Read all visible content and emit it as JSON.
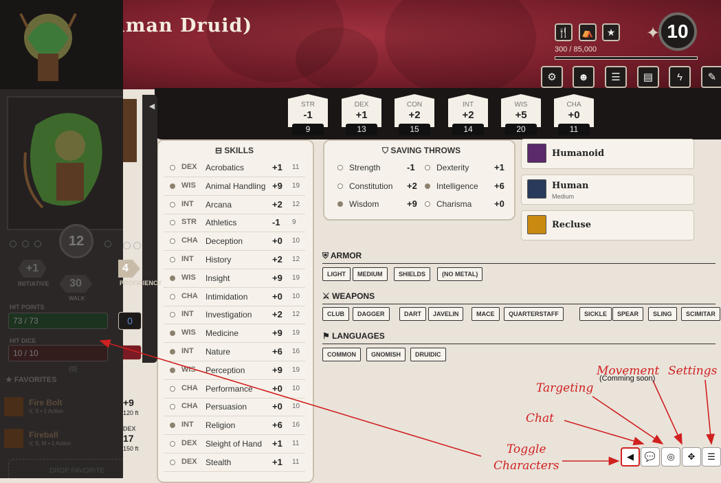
{
  "header": {
    "title": "(Human Druid)",
    "xp": "300 / 85,000",
    "level": "10",
    "icons": [
      "utensils-icon",
      "camp-icon",
      "star-icon"
    ],
    "tools": [
      "gear-icon",
      "character-icon",
      "list-icon",
      "book-icon",
      "lightning-icon",
      "feather-icon"
    ]
  },
  "sidebar": {
    "ac": "12",
    "initiative": "+1",
    "initiative_label": "INITIATIVE",
    "walk": "30",
    "walk_label": "WALK",
    "proficiency": "4",
    "proficiency_label": "PROFICIENCY",
    "hp_label": "HIT POINTS",
    "hp": "73 / 73",
    "hp_temp": "0",
    "hit_dice_label": "HIT DICE",
    "hit_dice": "10 / 10",
    "hit_dice_extra": "(0)",
    "favorites_label": "FAVORITES",
    "favorites": [
      {
        "name": "Fire Bolt",
        "sub": "V, S • 1 Action",
        "bonus": "+9",
        "range": "120 ft"
      },
      {
        "name": "Fireball",
        "sub": "V, S, M • 1 Action",
        "stat": "DEX",
        "bonus": "17",
        "range": "150 ft"
      }
    ],
    "drop_text": "DROP FAVORITE"
  },
  "stats": [
    {
      "label": "STR",
      "mod": "-1",
      "score": "9"
    },
    {
      "label": "DEX",
      "mod": "+1",
      "score": "13"
    },
    {
      "label": "CON",
      "mod": "+2",
      "score": "15"
    },
    {
      "label": "INT",
      "mod": "+2",
      "score": "14"
    },
    {
      "label": "WIS",
      "mod": "+5",
      "score": "20"
    },
    {
      "label": "CHA",
      "mod": "+0",
      "score": "11"
    }
  ],
  "skills": {
    "title": "SKILLS",
    "rows": [
      {
        "ab": "DEX",
        "name": "Acrobatics",
        "bonus": "+1",
        "passive": "11",
        "prof": false
      },
      {
        "ab": "WIS",
        "name": "Animal Handling",
        "bonus": "+9",
        "passive": "19",
        "prof": true
      },
      {
        "ab": "INT",
        "name": "Arcana",
        "bonus": "+2",
        "passive": "12",
        "prof": false
      },
      {
        "ab": "STR",
        "name": "Athletics",
        "bonus": "-1",
        "passive": "9",
        "prof": false
      },
      {
        "ab": "CHA",
        "name": "Deception",
        "bonus": "+0",
        "passive": "10",
        "prof": false
      },
      {
        "ab": "INT",
        "name": "History",
        "bonus": "+2",
        "passive": "12",
        "prof": false
      },
      {
        "ab": "WIS",
        "name": "Insight",
        "bonus": "+9",
        "passive": "19",
        "prof": true
      },
      {
        "ab": "CHA",
        "name": "Intimidation",
        "bonus": "+0",
        "passive": "10",
        "prof": false
      },
      {
        "ab": "INT",
        "name": "Investigation",
        "bonus": "+2",
        "passive": "12",
        "prof": false
      },
      {
        "ab": "WIS",
        "name": "Medicine",
        "bonus": "+9",
        "passive": "19",
        "prof": true
      },
      {
        "ab": "INT",
        "name": "Nature",
        "bonus": "+6",
        "passive": "16",
        "prof": true
      },
      {
        "ab": "WIS",
        "name": "Perception",
        "bonus": "+9",
        "passive": "19",
        "prof": true
      },
      {
        "ab": "CHA",
        "name": "Performance",
        "bonus": "+0",
        "passive": "10",
        "prof": false
      },
      {
        "ab": "CHA",
        "name": "Persuasion",
        "bonus": "+0",
        "passive": "10",
        "prof": false
      },
      {
        "ab": "INT",
        "name": "Religion",
        "bonus": "+6",
        "passive": "16",
        "prof": true
      },
      {
        "ab": "DEX",
        "name": "Sleight of Hand",
        "bonus": "+1",
        "passive": "11",
        "prof": false
      },
      {
        "ab": "DEX",
        "name": "Stealth",
        "bonus": "+1",
        "passive": "11",
        "prof": false
      }
    ]
  },
  "saves": {
    "title": "SAVING THROWS",
    "rows": [
      {
        "name": "Strength",
        "bonus": "-1",
        "prof": false
      },
      {
        "name": "Dexterity",
        "bonus": "+1",
        "prof": false
      },
      {
        "name": "Constitution",
        "bonus": "+2",
        "prof": false
      },
      {
        "name": "Intelligence",
        "bonus": "+6",
        "prof": true
      },
      {
        "name": "Wisdom",
        "bonus": "+9",
        "prof": true
      },
      {
        "name": "Charisma",
        "bonus": "+0",
        "prof": false
      }
    ]
  },
  "traits": [
    {
      "name": "Humanoid",
      "sub": ""
    },
    {
      "name": "Human",
      "sub": "Medium"
    },
    {
      "name": "Recluse",
      "sub": ""
    }
  ],
  "armor": {
    "title": "ARMOR",
    "tags": [
      "LIGHT",
      "MEDIUM",
      "SHIELDS",
      "(NO METAL)"
    ]
  },
  "weapons": {
    "title": "WEAPONS",
    "tags": [
      "CLUB",
      "DAGGER",
      "DART",
      "JAVELIN",
      "MACE",
      "QUARTERSTAFF",
      "SICKLE",
      "SPEAR",
      "SLING",
      "SCIMITAR"
    ]
  },
  "languages": {
    "title": "LANGUAGES",
    "tags": [
      "COMMON",
      "GNOMISH",
      "DRUIDIC"
    ]
  },
  "annotations": {
    "movement": "Movement",
    "movement_sub": "(Comming soon)",
    "settings": "Settings",
    "targeting": "Targeting",
    "chat": "Chat",
    "toggle1": "Toggle",
    "toggle2": "Characters"
  },
  "colors": {
    "accent": "#d02020",
    "header": "#8a2432"
  }
}
